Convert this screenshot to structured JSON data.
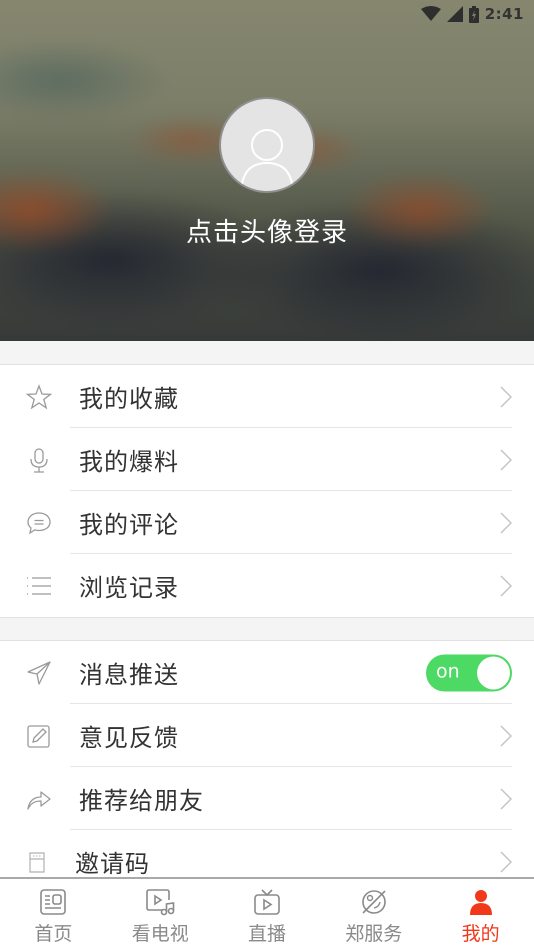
{
  "status_bar": {
    "time": "2:41",
    "icons": [
      "wifi-icon",
      "cell-signal-icon",
      "battery-charging-icon"
    ]
  },
  "header": {
    "avatar_icon": "user-placeholder-icon",
    "login_prompt": "点击头像登录"
  },
  "menu_group_1": [
    {
      "icon": "star-icon",
      "label": "我的收藏"
    },
    {
      "icon": "microphone-icon",
      "label": "我的爆料"
    },
    {
      "icon": "comment-icon",
      "label": "我的评论"
    },
    {
      "icon": "list-icon",
      "label": "浏览记录"
    }
  ],
  "menu_group_2": [
    {
      "icon": "send-icon",
      "label": "消息推送",
      "toggle": {
        "state": "on",
        "label": "on"
      }
    },
    {
      "icon": "edit-icon",
      "label": "意见反馈"
    },
    {
      "icon": "share-icon",
      "label": "推荐给朋友"
    },
    {
      "icon": "invite-code-icon",
      "label": "邀请码"
    }
  ],
  "bottom_nav": [
    {
      "icon": "news-icon",
      "label": "首页",
      "active": false
    },
    {
      "icon": "video-icon",
      "label": "看电视",
      "active": false
    },
    {
      "icon": "tv-icon",
      "label": "直播",
      "active": false
    },
    {
      "icon": "service-icon",
      "label": "郑服务",
      "active": false
    },
    {
      "icon": "person-icon",
      "label": "我的",
      "active": true
    }
  ],
  "colors": {
    "accent": "#f1381a",
    "toggle_on": "#4cd964",
    "text": "#333333",
    "icon_gray": "#8a8a8a"
  }
}
